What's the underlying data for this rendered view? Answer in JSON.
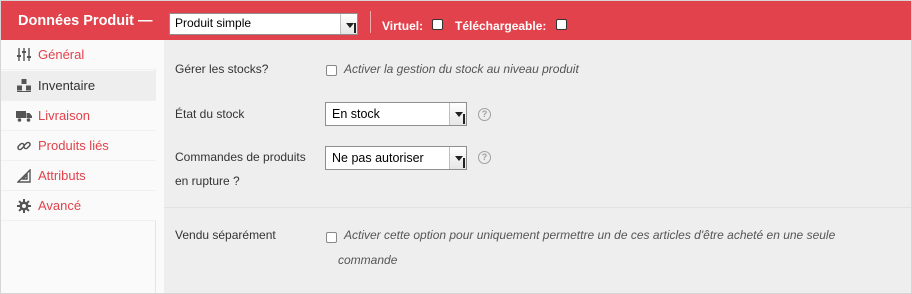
{
  "header": {
    "title": "Données Produit —",
    "product_type": "Produit simple",
    "virtual_label": "Virtuel:",
    "downloadable_label": "Téléchargeable:",
    "accent_color": "#e2424b"
  },
  "sidebar": {
    "items": [
      {
        "label": "Général",
        "icon": "sliders-icon"
      },
      {
        "label": "Inventaire",
        "icon": "boxes-icon",
        "active": true
      },
      {
        "label": "Livraison",
        "icon": "truck-icon"
      },
      {
        "label": "Produits liés",
        "icon": "link-icon"
      },
      {
        "label": "Attributs",
        "icon": "set-square-icon"
      },
      {
        "label": "Avancé",
        "icon": "gear-icon"
      }
    ]
  },
  "inventory": {
    "manage_stock": {
      "label": "Gérer les stocks?",
      "description": "Activer la gestion du stock au niveau produit",
      "checked": false
    },
    "stock_status": {
      "label": "État du stock",
      "value": "En stock",
      "help": "?"
    },
    "backorders": {
      "label_line1": "Commandes de produits",
      "label_line2": "en rupture ?",
      "value": "Ne pas autoriser",
      "help": "?"
    },
    "sold_individually": {
      "label": "Vendu séparément",
      "description_line1": "Activer cette option pour uniquement permettre un de ces articles d'être acheté en une seule",
      "description_line2": "commande",
      "checked": false
    }
  }
}
